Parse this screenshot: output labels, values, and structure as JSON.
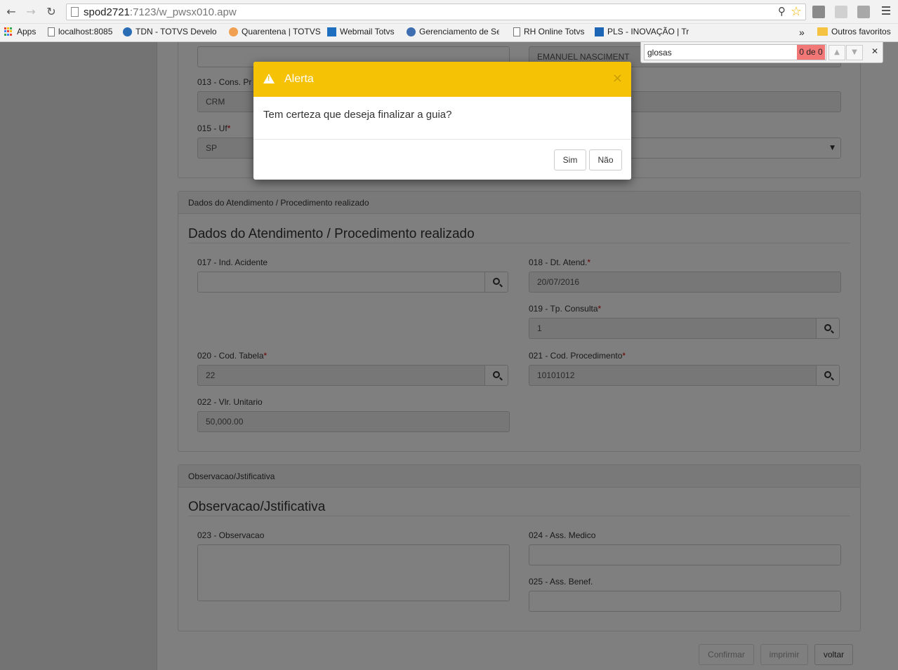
{
  "browser": {
    "url_host": "spod2721",
    "url_path": ":7123/w_pwsx010.apw",
    "bookmarks": [
      "Apps",
      "localhost:8085",
      "TDN - TOTVS Develop",
      "Quarentena | TOTVS",
      "Webmail Totvs",
      "Gerenciamento de Se",
      "RH Online Totvs",
      "PLS - INOVAÇÃO | Tre",
      "Outros favoritos"
    ],
    "more_bookmarks": "»"
  },
  "find_bar": {
    "query": "glosas",
    "count": "0 de 0"
  },
  "form_top": {
    "field_012_value": "",
    "field_014_value": "EMANUEL NASCIMENT",
    "label_013": "013 - Cons. Pr",
    "field_013_value": "CRM",
    "label_015": "015 - Uf",
    "field_015_value": "SP",
    "required_mark": "*"
  },
  "section_atendimento": {
    "header": "Dados do Atendimento / Procedimento realizado",
    "title": "Dados do Atendimento / Procedimento realizado",
    "label_017": "017 - Ind. Acidente",
    "value_017": "",
    "label_018": "018 - Dt. Atend.",
    "value_018": "20/07/2016",
    "label_019": "019 - Tp. Consulta",
    "value_019": "1",
    "label_020": "020 - Cod. Tabela",
    "value_020": "22",
    "label_021": "021 - Cod. Procedimento",
    "value_021": "10101012",
    "label_022": "022 - Vlr. Unitario",
    "value_022": "50,000.00"
  },
  "section_obs": {
    "header": "Observacao/Jstificativa",
    "title": "Observacao/Jstificativa",
    "label_023": "023 - Observacao",
    "label_024": "024 - Ass. Medico",
    "label_025": "025 - Ass. Benef."
  },
  "actions": {
    "confirm": "Confirmar",
    "print": "imprimir",
    "back": "voltar"
  },
  "modal": {
    "title": "Alerta",
    "close": "×",
    "message": "Tem certeza que deseja finalizar a guia?",
    "yes": "Sim",
    "no": "Não"
  },
  "colors": {
    "modal_header": "#f6c206",
    "find_no_match": "#f27878"
  }
}
